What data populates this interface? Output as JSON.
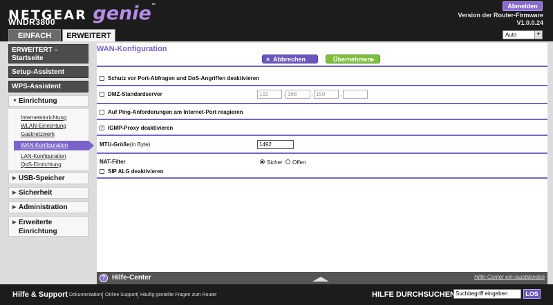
{
  "header": {
    "brand": "NETGEAR",
    "product": "genie",
    "trademark": "™",
    "model": "WNDR3800",
    "logout_label": "Abmelden",
    "firmware_label": "Version der Router-Firmware",
    "firmware_version": "V1.0.0.24",
    "language": "Auto"
  },
  "tabs": {
    "basic": "EINFACH",
    "advanced": "ERWEITERT"
  },
  "sidebar": {
    "advanced_home": "ERWEITERT – Startseite",
    "setup_wizard": "Setup-Assistent",
    "wps_wizard": "WPS-Assistent",
    "setup": "Einrichtung",
    "setup_items": [
      "Interneteinrichtung",
      "WLAN-Einrichtung",
      "Gastnetzwerk",
      "WAN-Konfiguration",
      "LAN-Konfiguration",
      "QoS-Einrichtung"
    ],
    "usb_storage": "USB-Speicher",
    "security": "Sicherheit",
    "administration": "Administration",
    "advanced_setup_line1": "Erweiterte",
    "advanced_setup_line2": "Einrichtung",
    "tri_right": "▶",
    "tri_down": "▼"
  },
  "main": {
    "title": "WAN-Konfiguration",
    "cancel_label": "Abbrechen",
    "cancel_icon": "×",
    "apply_label": "Übernehmen▸",
    "dos_label": "Schutz vor Port-Abfragen und DoS-Angriffen deaktivieren",
    "dos_checked": false,
    "dmz_label": "DMZ-Standardserver",
    "dmz_checked": false,
    "dmz_ip": [
      "192",
      "168",
      "150",
      ""
    ],
    "ping_label": "Auf Ping-Anforderungen am Internet-Port reagieren",
    "ping_checked": false,
    "igmp_label": "IGMP-Proxy deaktivieren",
    "igmp_checked": true,
    "checkmark": "✓",
    "mtu_label": "MTU-Größe",
    "mtu_unit": "(in Byte)",
    "mtu_value": "1492",
    "nat_label": "NAT-Filter",
    "nat_option_secure": "Sicher",
    "nat_option_open": "Offen",
    "nat_selected": "Sicher",
    "sip_label": "SIP ALG deaktivieren",
    "sip_checked": false
  },
  "help": {
    "icon_text": "?",
    "title": "Hilfe-Center",
    "toggle_label": "Hilfe-Center ein-/ausblenden"
  },
  "footer": {
    "title": "Hilfe & Support",
    "links": [
      "Dokumentation",
      "Online Support",
      "Häufig gestellte Fragen zum Router"
    ],
    "search_title": "HILFE DURCHSUCHEN",
    "search_placeholder": "Suchbegriff eingeben",
    "search_button": "LOS"
  }
}
